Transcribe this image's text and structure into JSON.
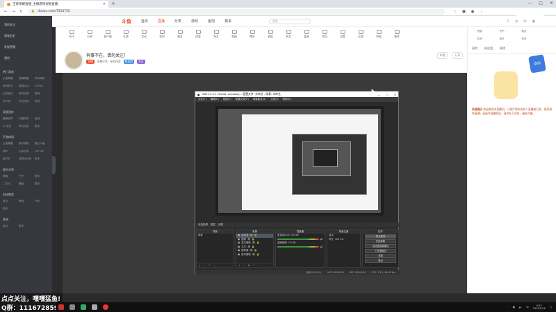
{
  "browser": {
    "tab_title": "王者荣耀直播_主播游戏视频直播",
    "url": "douyu.com/7553755",
    "window_controls": [
      "—",
      "□",
      "✕"
    ]
  },
  "site": {
    "logo": "斗鱼",
    "nav": [
      "首页",
      "直播",
      "分类",
      "游戏",
      "鱼吧",
      "赛事"
    ],
    "active_nav": 1,
    "search_placeholder": "搜索"
  },
  "sidebar": {
    "top_items": [
      "我的关注",
      "观看历史",
      "发现直播",
      "我的"
    ],
    "sections": [
      {
        "title": "热门游戏",
        "items": [
          "王者荣耀",
          "英雄联盟",
          "和平精英",
          "绝地求生",
          "穿越火线",
          "DOTA2",
          "主机游戏",
          "单机热游",
          "原神",
          "地下城",
          "炉石传说",
          "其他"
        ]
      },
      {
        "title": "网游竞技",
        "items": [
          "魔兽世界",
          "守望先锋",
          "逆战",
          "CF手游",
          "梦幻西游",
          "更多"
        ]
      },
      {
        "title": "手游休闲",
        "items": [
          "王者荣耀",
          "和平精英",
          "第五人格",
          "崩坏",
          "火影忍者",
          "QQ飞车",
          "金铲铲",
          "球球大作战",
          "更多"
        ]
      },
      {
        "title": "娱乐天地",
        "items": [
          "颜值",
          "户外",
          "音乐",
          "二次元",
          "舞蹈",
          "更多"
        ]
      },
      {
        "title": "科技教育",
        "items": [
          "科技",
          "教育",
          "汽车",
          "更多"
        ]
      },
      {
        "title": "其他",
        "items": [
          "综合",
          "更多"
        ]
      }
    ]
  },
  "room": {
    "title": "有事不在，请勿关注！",
    "subtitle": "直播分类 · 单机热游",
    "badges": [
      "主播",
      "粉丝团",
      "关注"
    ],
    "level": "12",
    "toolbar": [
      "关注",
      "分享",
      "客户端",
      "礼物",
      "活动",
      "签到",
      "抽奖",
      "房管",
      "鱼丸",
      "鱼翅",
      "喇叭",
      "贵族",
      "任务",
      "道具",
      "背包",
      "设置",
      "反馈",
      "举报",
      "更多"
    ],
    "right_pills": [
      "举报",
      "分享"
    ]
  },
  "right_panel": {
    "tools": [
      "贵族",
      "守护",
      "粉丝",
      "礼物",
      "排行",
      "任务"
    ],
    "tabs": [
      "贵宾",
      "粉丝团",
      "周榜"
    ],
    "notice_label": "系统提示",
    "notice": "欢迎来到本直播间，斗鱼严禁未成年人直播或打赏，倡导绿色直播，请遵守直播规范，请勿私下交易，谨防诈骗。",
    "float_label": "活动"
  },
  "obs": {
    "title": "OBS 27.0.1 (64-bit, windows) - 配置文件: 未命名 - 场景: 未命名",
    "menu": [
      "文件(F)",
      "编辑(E)",
      "视图(V)",
      "配置文件(P)",
      "场景集合(S)",
      "工具(T)",
      "帮助(H)"
    ],
    "bar_label": "未选择源",
    "bar_buttons": [
      "属性",
      "滤镜"
    ],
    "docks": {
      "scenes": {
        "title": "场景",
        "items": [
          "场景"
        ]
      },
      "sources": {
        "title": "来源",
        "items": [
          "游戏源",
          "图像",
          "显示捕获",
          "文本",
          "媒体源",
          "窗口捕获"
        ]
      },
      "mixer": {
        "title": "混音器",
        "channels": [
          {
            "name": "麦克风/Aux",
            "db": "0.0 dB"
          },
          {
            "name": "桌面音频",
            "db": "0.0 dB"
          }
        ]
      },
      "transitions": {
        "title": "场景过渡",
        "type": "淡出",
        "duration_label": "时长",
        "duration": "300 ms"
      },
      "controls": {
        "title": "控件",
        "buttons": [
          "停止推流",
          "开始录制",
          "启动虚拟摄像机",
          "工作室模式",
          "设置",
          "退出"
        ]
      }
    },
    "status": [
      "丢帧 0 (0.0%)",
      "LIVE: 00:00:00",
      "REC: 00:00:00",
      "CPU: 1.5%, 60.00 fps"
    ]
  },
  "overlay": {
    "line1": "点点关注，嘿嘿猛鱼!",
    "line2": "Q群：111672859"
  },
  "taskbar": {
    "time": "8:55",
    "date": "2022/2/26"
  }
}
